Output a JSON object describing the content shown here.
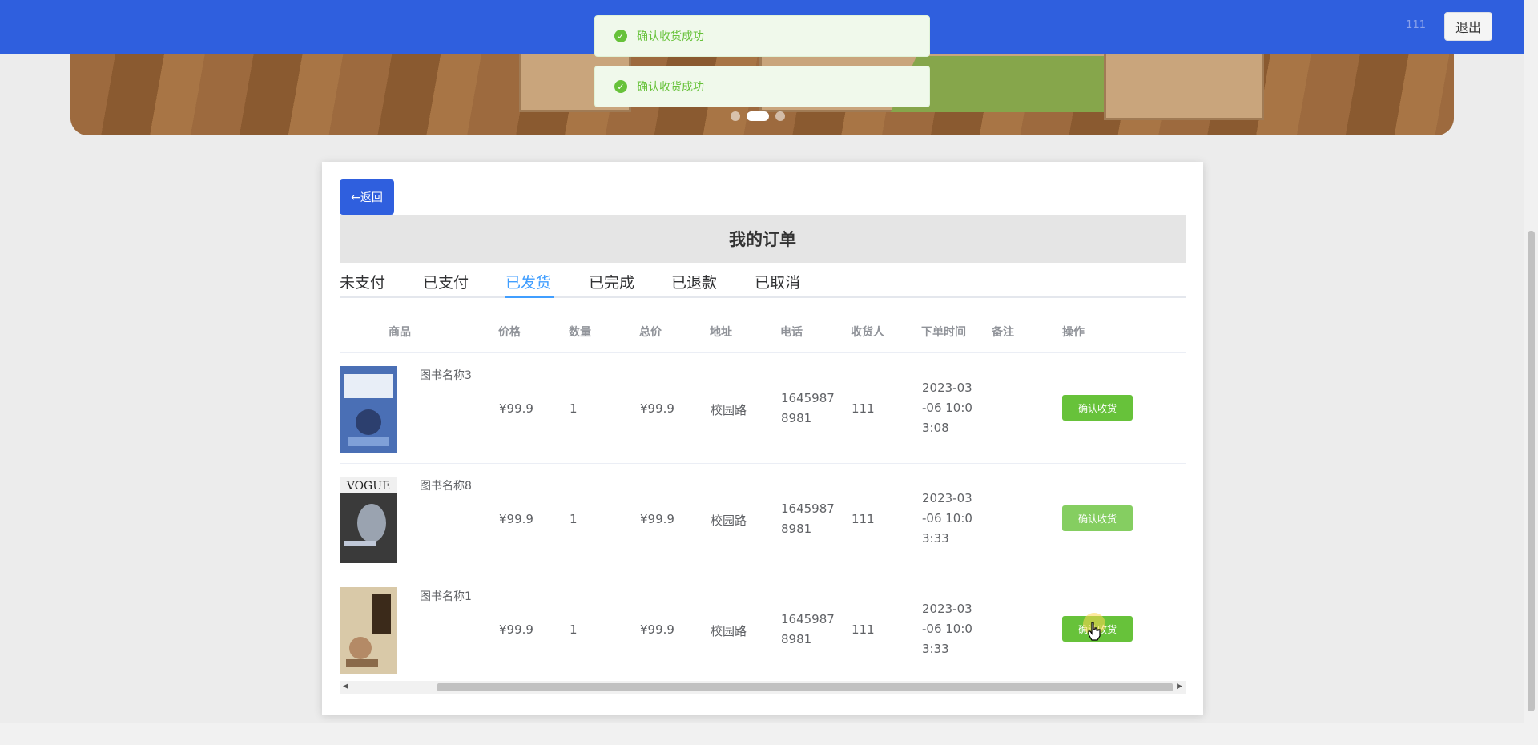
{
  "header": {
    "user": "111",
    "logout_label": "退出"
  },
  "toasts": [
    {
      "message": "确认收货成功"
    },
    {
      "message": "确认收货成功"
    }
  ],
  "carousel": {
    "slide_count": 3,
    "active_index": 1
  },
  "card": {
    "back_label": "←返回",
    "title": "我的订单",
    "tabs": [
      {
        "label": "未支付",
        "active": false
      },
      {
        "label": "已支付",
        "active": false
      },
      {
        "label": "已发货",
        "active": true
      },
      {
        "label": "已完成",
        "active": false
      },
      {
        "label": "已退款",
        "active": false
      },
      {
        "label": "已取消",
        "active": false
      }
    ]
  },
  "table": {
    "columns": [
      "商品",
      "价格",
      "数量",
      "总价",
      "地址",
      "电话",
      "收货人",
      "下单时间",
      "备注",
      "操作"
    ],
    "rows": [
      {
        "name": "图书名称3",
        "price": "¥99.9",
        "qty": "1",
        "total": "¥99.9",
        "address": "校园路",
        "phone_l1": "1645987",
        "phone_l2": "8981",
        "receiver": "111",
        "time_l1": "2023-03",
        "time_l2": "-06 10:0",
        "time_l3": "3:08",
        "note": "",
        "action": "确认收货",
        "cover": "blue-cover-icon"
      },
      {
        "name": "图书名称8",
        "price": "¥99.9",
        "qty": "1",
        "total": "¥99.9",
        "address": "校园路",
        "phone_l1": "1645987",
        "phone_l2": "8981",
        "receiver": "111",
        "time_l1": "2023-03",
        "time_l2": "-06 10:0",
        "time_l3": "3:33",
        "note": "",
        "action": "确认收货",
        "cover": "vogue-cover-icon"
      },
      {
        "name": "图书名称1",
        "price": "¥99.9",
        "qty": "1",
        "total": "¥99.9",
        "address": "校园路",
        "phone_l1": "1645987",
        "phone_l2": "8981",
        "receiver": "111",
        "time_l1": "2023-03",
        "time_l2": "-06 10:0",
        "time_l3": "3:33",
        "note": "",
        "action": "确认收货",
        "cover": "beige-cover-icon"
      }
    ]
  },
  "colors": {
    "primary": "#2f5fde",
    "success": "#67c23a",
    "tab_active": "#409eff"
  }
}
